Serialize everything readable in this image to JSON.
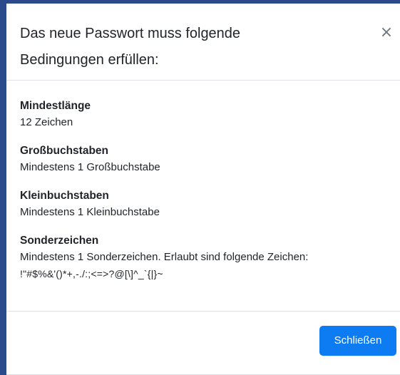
{
  "modal": {
    "title": "Das neue Passwort muss folgende Bedingungen erfüllen:",
    "close_icon": "×",
    "rules": [
      {
        "title": "Mindestlänge",
        "description": "12 Zeichen"
      },
      {
        "title": "Großbuchstaben",
        "description": "Mindestens 1 Großbuchstabe"
      },
      {
        "title": "Kleinbuchstaben",
        "description": "Mindestens 1 Kleinbuchstabe"
      },
      {
        "title": "Sonderzeichen",
        "description": "Mindestens 1 Sonderzeichen. Erlaubt sind folgende Zeichen:",
        "allowed_chars": "!\"#$%&'()*+,-./:;<=>?@[\\]^_`{|}~"
      }
    ],
    "footer": {
      "close_label": "Schließen"
    }
  },
  "colors": {
    "frame": "#2b4a8b",
    "primary_button": "#0d7bf2",
    "divider": "#dee2e6",
    "close_icon": "#6c757d"
  }
}
